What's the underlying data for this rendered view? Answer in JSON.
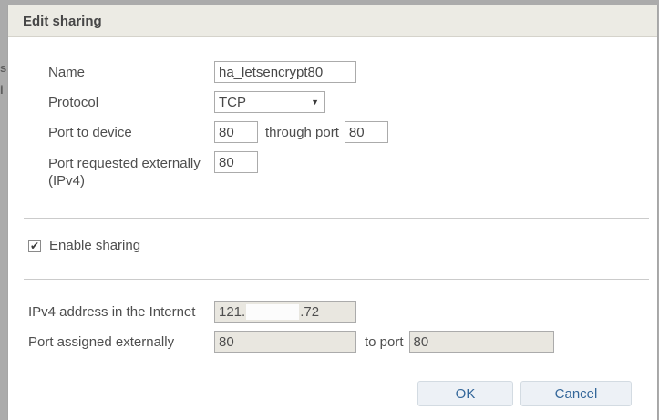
{
  "background_fragments": {
    "frag1": "s",
    "frag2": "i"
  },
  "icons": {
    "check": "✔",
    "dropdown": "▼"
  },
  "dialog": {
    "title": "Edit sharing",
    "fields": {
      "name": {
        "label": "Name",
        "value": "ha_letsencrypt80"
      },
      "protocol": {
        "label": "Protocol",
        "value": "TCP"
      },
      "port_to_device": {
        "label": "Port to device",
        "value": "80",
        "through_label": "through port",
        "through_value": "80"
      },
      "port_requested": {
        "label_line1": "Port requested externally",
        "label_line2": "(IPv4)",
        "value": "80"
      },
      "enable_sharing": {
        "label": "Enable sharing",
        "checked": true
      },
      "ipv4_address": {
        "label": "IPv4 address in the Internet",
        "value_prefix": "121.",
        "value_suffix": ".72"
      },
      "port_assigned": {
        "label": "Port assigned externally",
        "value": "80",
        "to_label": "to port",
        "to_value": "80"
      }
    },
    "buttons": {
      "ok": "OK",
      "cancel": "Cancel"
    },
    "colors": {
      "titlebar_bg": "#ECEBE4",
      "backdrop": "#ABABAB",
      "disabled_input_bg": "#E9E7E0",
      "button_text_blue": "#34679A"
    }
  }
}
